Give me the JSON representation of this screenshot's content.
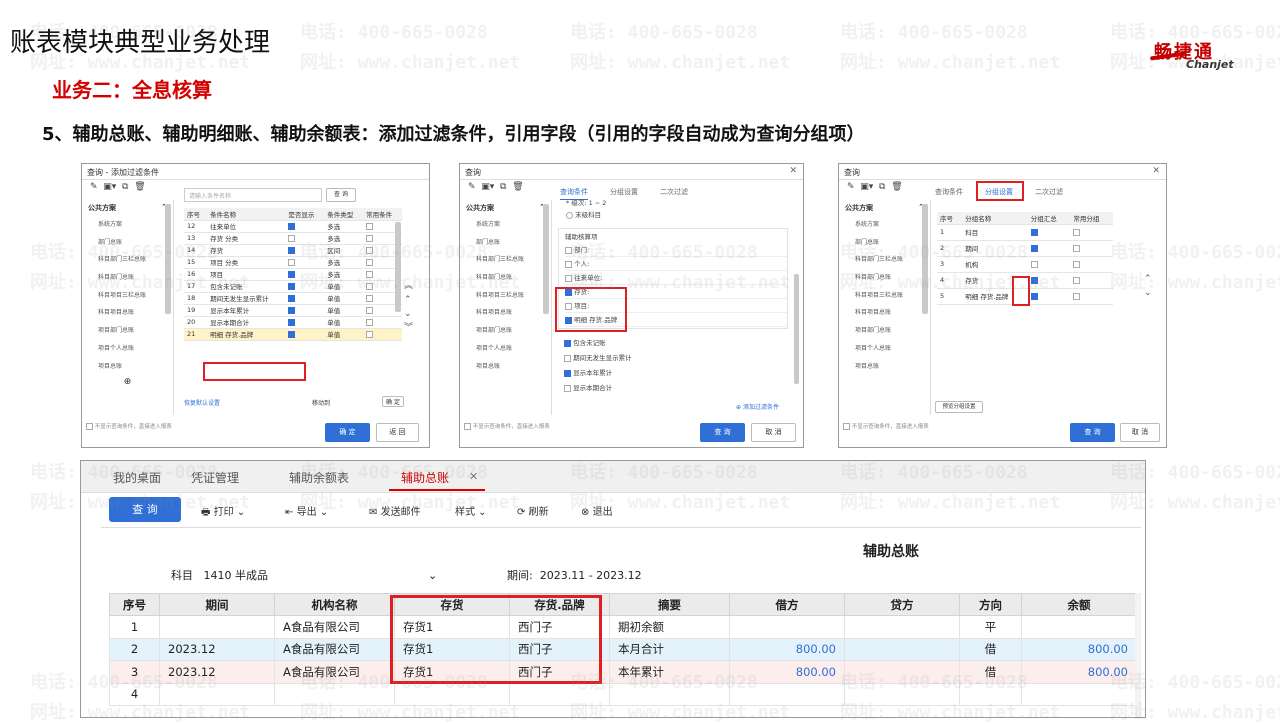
{
  "watermark": {
    "phone": "电话: 400-665-0028",
    "site": "网址: www.chanjet.net"
  },
  "slide": {
    "title": "账表模块典型业务处理",
    "subtitle": "业务二：全息核算",
    "heading": "5、辅助总账、辅助明细账、辅助余额表：添加过滤条件，引用字段（引用的字段自动成为查询分组项）"
  },
  "logo": {
    "cn": "畅捷通",
    "en": "Chanjet"
  },
  "dialog1": {
    "title": "查询 - 添加过滤条件",
    "search_placeholder": "请输入条件名称",
    "search_btn": "查 询",
    "left_header": "公共方案",
    "left_items": [
      "系统方案",
      "部门总账",
      "科目部门三栏总账",
      "科目部门总账",
      "科目项目三栏总账",
      "科目项目总账",
      "项目部门总账",
      "项目个人总账",
      "项目总账"
    ],
    "cols": [
      "序号",
      "条件名称",
      "是否显示",
      "条件类型",
      "常用条件"
    ],
    "rows": [
      {
        "no": "12",
        "name": "往来单位",
        "show": true,
        "type": "多选",
        "common": false
      },
      {
        "no": "13",
        "name": "存货 分类",
        "show": false,
        "type": "多选",
        "common": false
      },
      {
        "no": "14",
        "name": "存货",
        "show": true,
        "type": "区间",
        "common": false
      },
      {
        "no": "15",
        "name": "项目 分类",
        "show": false,
        "type": "多选",
        "common": false
      },
      {
        "no": "16",
        "name": "项目",
        "show": true,
        "type": "多选",
        "common": false
      },
      {
        "no": "17",
        "name": "包含未记账",
        "show": true,
        "type": "单值",
        "common": false
      },
      {
        "no": "18",
        "name": "期间无发生显示累计",
        "show": true,
        "type": "单值",
        "common": false
      },
      {
        "no": "19",
        "name": "显示本年累计",
        "show": true,
        "type": "单值",
        "common": false
      },
      {
        "no": "20",
        "name": "显示本期合计",
        "show": true,
        "type": "单值",
        "common": false
      },
      {
        "no": "21",
        "name": "明细 存货.品牌",
        "show": true,
        "type": "单值",
        "common": false
      }
    ],
    "bottom_left": "恢复默认设置",
    "bottom_mid": "移动到",
    "bottom_right": "确 定",
    "ok": "确 定",
    "cancel": "返 回",
    "footer": "不显示查询条件，直接进入报表"
  },
  "dialog2": {
    "title": "查询",
    "left_header": "公共方案",
    "left_items": [
      "系统方案",
      "部门总账",
      "科目部门三栏总账",
      "科目部门总账",
      "科目项目三栏总账",
      "科目项目总账",
      "项目部门总账",
      "项目个人总账",
      "项目总账"
    ],
    "tabs": [
      "查询条件",
      "分组设置",
      "二次过滤"
    ],
    "level_row": "* 级次: 1   ~  2",
    "unposted": "末级科目",
    "aux_header": "辅助核算项",
    "aux_items": [
      "部门:",
      "个人:",
      "往来单位:",
      "存货:",
      "项目:",
      "明细 存货.品牌"
    ],
    "options": [
      "包含未记账",
      "期间无发生显示累计",
      "显示本年累计",
      "显示本期合计"
    ],
    "add_filter": "添加过滤条件",
    "ok": "查 询",
    "cancel": "取 消",
    "footer": "不显示查询条件，直接进入报表"
  },
  "dialog3": {
    "title": "查询",
    "left_header": "公共方案",
    "left_items": [
      "系统方案",
      "部门总账",
      "科目部门三栏总账",
      "科目部门总账",
      "科目项目三栏总账",
      "科目项目总账",
      "项目部门总账",
      "项目个人总账",
      "项目总账"
    ],
    "tabs": [
      "查询条件",
      "分组设置",
      "二次过滤"
    ],
    "cols": [
      "序号",
      "分组名称",
      "分组汇总",
      "常用分组"
    ],
    "rows": [
      {
        "no": "1",
        "name": "科目",
        "sum": true
      },
      {
        "no": "2",
        "name": "期间",
        "sum": true
      },
      {
        "no": "3",
        "name": "机构",
        "sum": false
      },
      {
        "no": "4",
        "name": "存货",
        "sum": true
      },
      {
        "no": "5",
        "name": "明细 存货.品牌",
        "sum": true
      }
    ],
    "preset": "预览分组设置",
    "ok": "查 询",
    "cancel": "取 消",
    "footer": "不显示查询条件，直接进入报表"
  },
  "main": {
    "tabs": [
      "我的桌面",
      "凭证管理",
      "辅助余额表",
      "辅助总账"
    ],
    "query_btn": "查 询",
    "toolbar": [
      "打印",
      "导出",
      "发送邮件",
      "样式",
      "刷新",
      "退出"
    ],
    "report_title": "辅助总账",
    "subject_label": "科目",
    "subject_value": "1410 半成品",
    "period_label": "期间:",
    "period_value": "2023.11 - 2023.12",
    "headers": [
      "序号",
      "期间",
      "机构名称",
      "存货",
      "存货.品牌",
      "摘要",
      "借方",
      "贷方",
      "方向",
      "余额"
    ],
    "rows": [
      {
        "no": "1",
        "period": "",
        "org": "A食品有限公司",
        "inv": "存货1",
        "brand": "西门子",
        "summary": "期初余额",
        "debit": "",
        "credit": "",
        "dir": "平",
        "bal": ""
      },
      {
        "no": "2",
        "period": "2023.12",
        "org": "A食品有限公司",
        "inv": "存货1",
        "brand": "西门子",
        "summary": "本月合计",
        "debit": "800.00",
        "credit": "",
        "dir": "借",
        "bal": "800.00"
      },
      {
        "no": "3",
        "period": "2023.12",
        "org": "A食品有限公司",
        "inv": "存货1",
        "brand": "西门子",
        "summary": "本年累计",
        "debit": "800.00",
        "credit": "",
        "dir": "借",
        "bal": "800.00"
      },
      {
        "no": "4",
        "period": "",
        "org": "",
        "inv": "",
        "brand": "",
        "summary": "",
        "debit": "",
        "credit": "",
        "dir": "",
        "bal": ""
      }
    ]
  }
}
